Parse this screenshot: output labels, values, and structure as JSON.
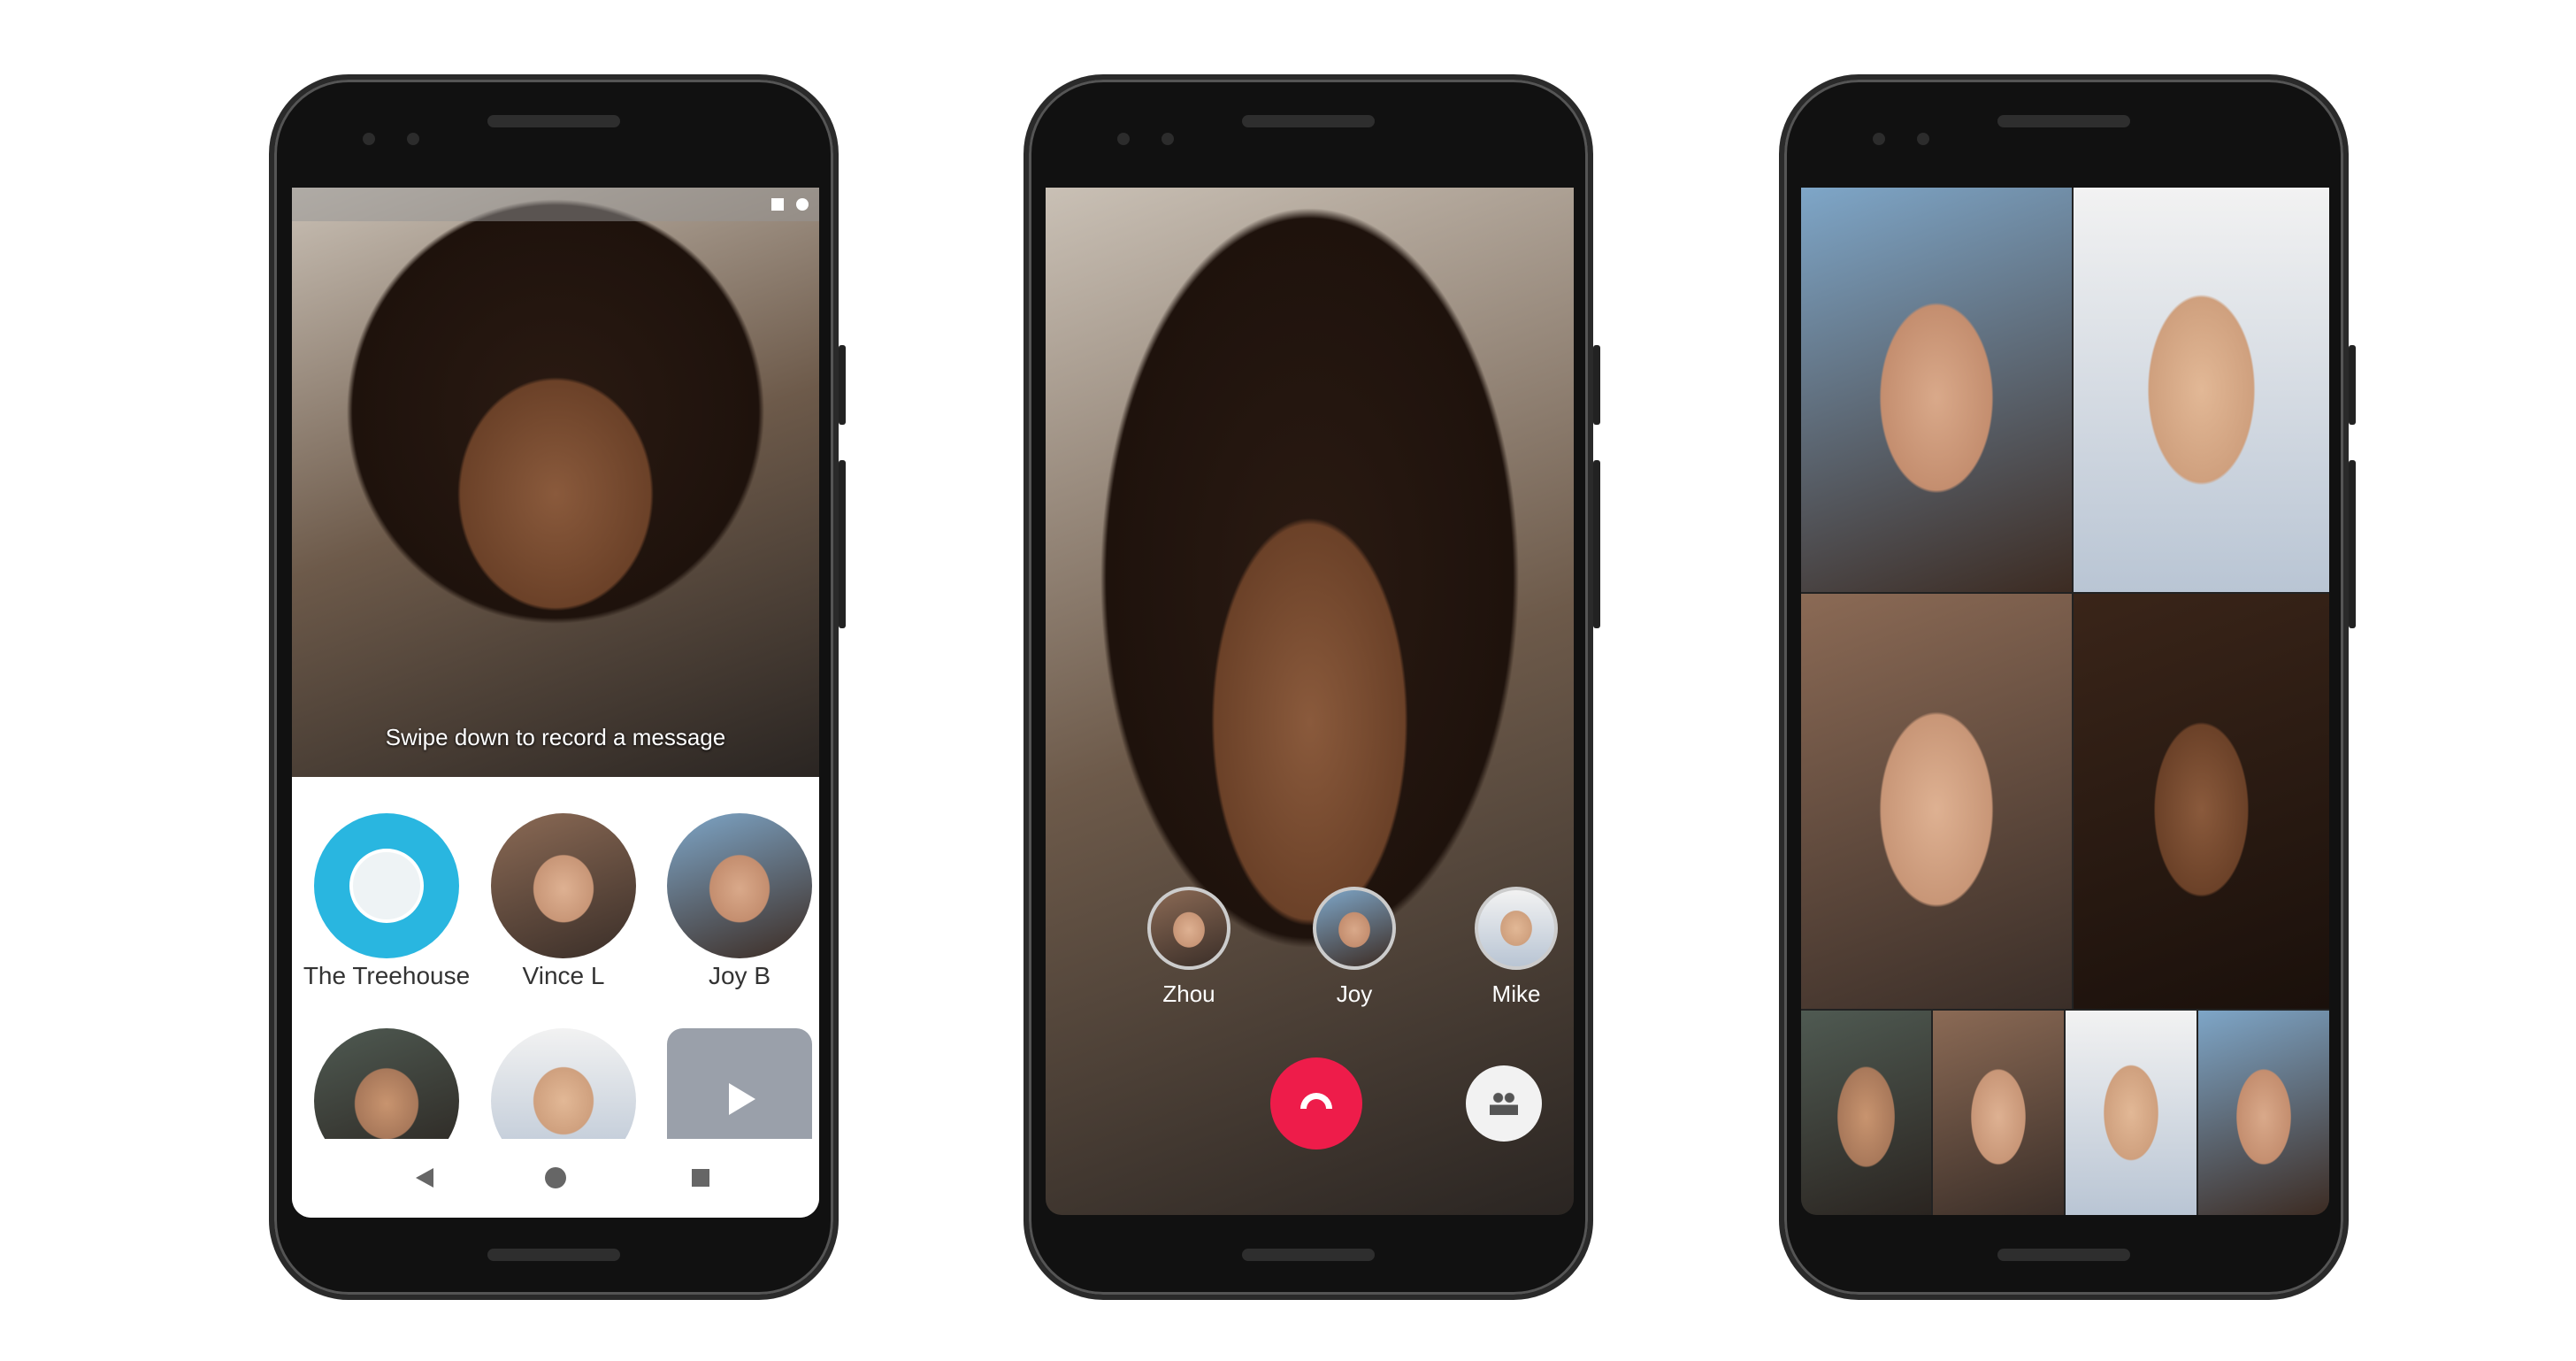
{
  "phone1": {
    "hint": "Swipe down to record a message",
    "contacts": [
      {
        "name": "The Treehouse"
      },
      {
        "name": "Vince L"
      },
      {
        "name": "Joy B"
      }
    ],
    "accent": "#29b6e0"
  },
  "phone2": {
    "participants": [
      {
        "name": "Zhou"
      },
      {
        "name": "Joy"
      },
      {
        "name": "Mike"
      }
    ],
    "end_call_color": "#ee1c4a"
  }
}
